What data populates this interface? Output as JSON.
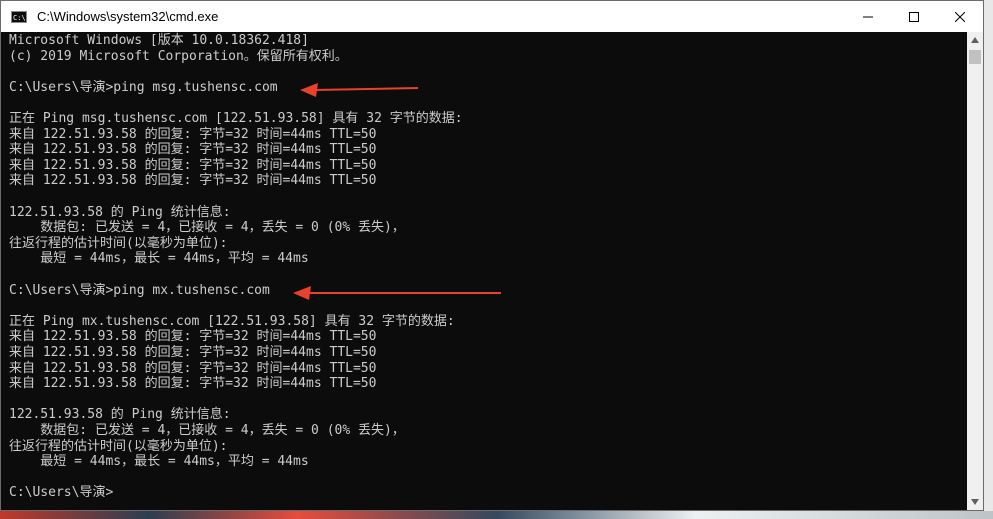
{
  "window": {
    "title": "C:\\Windows\\system32\\cmd.exe",
    "icon_label": "C:\\",
    "controls": {
      "minimize_icon": "minimize-icon",
      "maximize_icon": "maximize-icon",
      "close_icon": "close-icon"
    }
  },
  "console": {
    "background": "#0c0c0c",
    "foreground": "#cccccc",
    "lines": [
      "Microsoft Windows [版本 10.0.18362.418]",
      "(c) 2019 Microsoft Corporation。保留所有权利。",
      "",
      "C:\\Users\\导演>ping msg.tushensc.com",
      "",
      "正在 Ping msg.tushensc.com [122.51.93.58] 具有 32 字节的数据:",
      "来自 122.51.93.58 的回复: 字节=32 时间=44ms TTL=50",
      "来自 122.51.93.58 的回复: 字节=32 时间=44ms TTL=50",
      "来自 122.51.93.58 的回复: 字节=32 时间=44ms TTL=50",
      "来自 122.51.93.58 的回复: 字节=32 时间=44ms TTL=50",
      "",
      "122.51.93.58 的 Ping 统计信息:",
      "    数据包: 已发送 = 4，已接收 = 4，丢失 = 0 (0% 丢失)，",
      "往返行程的估计时间(以毫秒为单位):",
      "    最短 = 44ms，最长 = 44ms，平均 = 44ms",
      "",
      "C:\\Users\\导演>ping mx.tushensc.com",
      "",
      "正在 Ping mx.tushensc.com [122.51.93.58] 具有 32 字节的数据:",
      "来自 122.51.93.58 的回复: 字节=32 时间=44ms TTL=50",
      "来自 122.51.93.58 的回复: 字节=32 时间=44ms TTL=50",
      "来自 122.51.93.58 的回复: 字节=32 时间=44ms TTL=50",
      "来自 122.51.93.58 的回复: 字节=32 时间=44ms TTL=50",
      "",
      "122.51.93.58 的 Ping 统计信息:",
      "    数据包: 已发送 = 4，已接收 = 4，丢失 = 0 (0% 丢失)，",
      "往返行程的估计时间(以毫秒为单位):",
      "    最短 = 44ms，最长 = 44ms，平均 = 44ms",
      "",
      "C:\\Users\\导演>"
    ]
  },
  "annotations": {
    "arrow_color": "#e8412c"
  }
}
